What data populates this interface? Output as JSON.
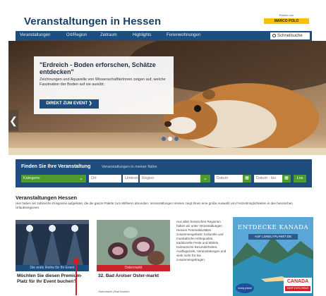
{
  "header": {
    "title": "Veranstaltungen in Hessen",
    "partner_text": "Partner von",
    "partner_logo": "MARCO POLO"
  },
  "nav": {
    "items": [
      "Veranstaltungen",
      "Ort/Region",
      "Zeitraum",
      "Highlights",
      "Ferienwohnungen"
    ],
    "search_label": "Schnellsuche",
    "search_icon": "search-icon"
  },
  "hero": {
    "title": "\"Erdreich - Boden erforschen, Schätze entdecken\"",
    "text": "Zeichnungen und Aquarelle von WissenschaftlerInnen zeigen auf, welche Faszination der Boden auf sie ausübt.",
    "button_label": "DIREKT ZUM EVENT ❯",
    "prev_arrow": "❮",
    "slides": 3,
    "active_slide": 1
  },
  "search_panel": {
    "title": "Finden Sie Ihre Veranstaltung",
    "subtitle": "Veranstaltungen in meiner Nähe",
    "category": "Kategorie",
    "place": "Ort",
    "or_label": "Umkreis",
    "region": "Region",
    "date": "Datum",
    "date_to": "Datum - bis",
    "go": "Los"
  },
  "events_section": {
    "title": "Veranstaltungen Hessen",
    "text": "Hier haben wir zahlreiche Ereignisse aufgelistet, die die ganze Palette zum Mitfeiern abrunden. Veranstaltungen Hessen zeigt Ihnen eine große Auswahl von Freizeitmöglichkeiten in den hessischen Urlaubsregionen."
  },
  "cards": [
    {
      "band": "Die erste Reihe für Ihr Event",
      "title": "Möchten Sie diesen Premium-Platz für Ihr Event buchen?",
      "meta": ""
    },
    {
      "band": "Ostermarkt",
      "title": "32. Bad Arolser Oster-markt",
      "meta": "Ostermarkt | Bad Arolsen"
    }
  ],
  "ad_text": "Aus allen hessischen Regionen haben wir unter Veranstaltungen Hessen Ferienaktivitäten zusammengefasst: Kulturelle und musikalische Höhepunkte, traditionelle Feste und Märkte, Kulinarische Besonderheiten, Ausflugsziele, Veranstaltungen und viele mehr für Sie zusammengetragen.",
  "ad_canada": {
    "headline": "ENTDECKE KANADA",
    "sub": "AUF LONELYPLANET.DE",
    "brand": "lonely planet",
    "flag": "CANADA",
    "flag_sub": "KEEP EXPLORING"
  },
  "colors": {
    "nav_blue": "#1d4e7e",
    "green": "#4f9b2f",
    "red": "#c9242b",
    "partner_yellow": "#f6c300"
  }
}
